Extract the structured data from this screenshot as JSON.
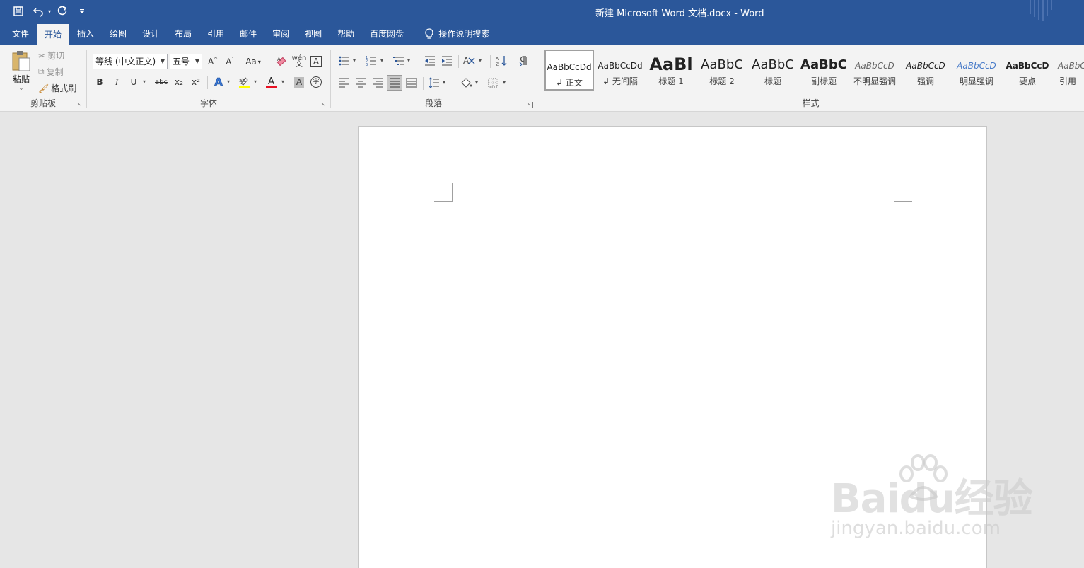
{
  "window": {
    "title": "新建 Microsoft Word 文档.docx  -  Word"
  },
  "quick_access": {
    "icons": [
      "save-icon",
      "undo-icon",
      "redo-icon",
      "customize-icon"
    ]
  },
  "tabs": [
    {
      "label": "文件"
    },
    {
      "label": "开始"
    },
    {
      "label": "插入"
    },
    {
      "label": "绘图"
    },
    {
      "label": "设计"
    },
    {
      "label": "布局"
    },
    {
      "label": "引用"
    },
    {
      "label": "邮件"
    },
    {
      "label": "审阅"
    },
    {
      "label": "视图"
    },
    {
      "label": "帮助"
    },
    {
      "label": "百度网盘"
    }
  ],
  "tell_me": {
    "label": "操作说明搜索",
    "icon": "lightbulb-icon"
  },
  "clipboard": {
    "paste": "粘贴",
    "cut": "剪切",
    "copy": "复制",
    "format_painter": "格式刷",
    "group_label": "剪贴板"
  },
  "font": {
    "font_name": "等线 (中文正文)",
    "font_size": "五号",
    "change_case": "Aa",
    "bold": "B",
    "italic": "I",
    "underline": "U",
    "strikethrough": "abc",
    "subscript": "x₂",
    "superscript": "x²",
    "group_label": "字体",
    "highlight_color": "#ffff00",
    "font_color": "#e81123"
  },
  "paragraph": {
    "group_label": "段落"
  },
  "styles": {
    "group_label": "样式",
    "items": [
      {
        "preview": "AaBbCcDd",
        "name": "↲ 正文"
      },
      {
        "preview": "AaBbCcDd",
        "name": "↲ 无间隔"
      },
      {
        "preview": "AaBl",
        "name": "标题 1"
      },
      {
        "preview": "AaBbC",
        "name": "标题 2"
      },
      {
        "preview": "AaBbC",
        "name": "标题"
      },
      {
        "preview": "AaBbC",
        "name": "副标题"
      },
      {
        "preview": "AaBbCcD",
        "name": "不明显强调"
      },
      {
        "preview": "AaBbCcD",
        "name": "强调"
      },
      {
        "preview": "AaBbCcD",
        "name": "明显强调"
      },
      {
        "preview": "AaBbCcD",
        "name": "要点"
      },
      {
        "preview": "AaBbCcD",
        "name": "引用"
      }
    ]
  },
  "watermark": {
    "main": "Baidu经验",
    "sub": "jingyan.baidu.com"
  },
  "colors": {
    "brand": "#2b579a",
    "ribbon": "#f3f3f3",
    "canvas": "#e6e6e6"
  }
}
